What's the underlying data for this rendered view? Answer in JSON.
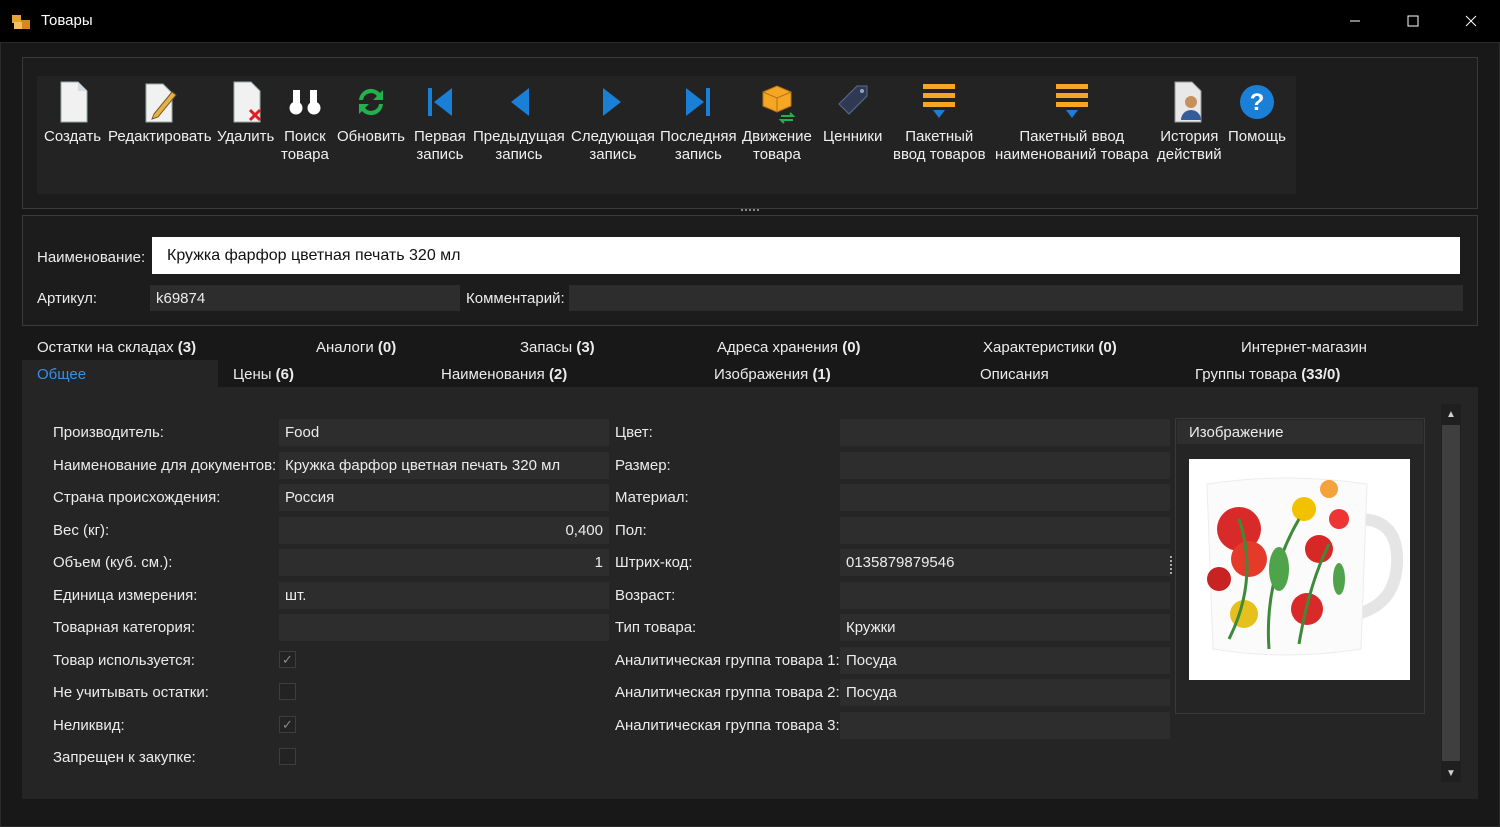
{
  "window": {
    "title": "Товары",
    "minimize": "—",
    "maximize": "☐",
    "close": "✕"
  },
  "toolbar": {
    "create": "Создать",
    "edit": "Редактировать",
    "delete": "Удалить",
    "search_l1": "Поиск",
    "search_l2": "товара",
    "refresh": "Обновить",
    "first_l1": "Первая",
    "first_l2": "запись",
    "prev_l1": "Предыдущая",
    "prev_l2": "запись",
    "next_l1": "Следующая",
    "next_l2": "запись",
    "last_l1": "Последняя",
    "last_l2": "запись",
    "move_l1": "Движение",
    "move_l2": "товара",
    "prices": "Ценники",
    "batch_l1": "Пакетный",
    "batch_l2": "ввод товаров",
    "batchnames_l1": "Пакетный ввод",
    "batchnames_l2": "наименований товара",
    "history_l1": "История",
    "history_l2": "действий",
    "help": "Помощь"
  },
  "header": {
    "name_label": "Наименование:",
    "name_value": "Кружка фарфор цветная печать 320 мл",
    "article_label": "Артикул:",
    "article_value": "k69874",
    "comment_label": "Комментарий:",
    "comment_value": ""
  },
  "tabs_row1": [
    {
      "label": "Остатки на складах ",
      "count": "(3)"
    },
    {
      "label": "Аналоги ",
      "count": "(0)"
    },
    {
      "label": "Запасы ",
      "count": "(3)"
    },
    {
      "label": "Адреса хранения ",
      "count": "(0)"
    },
    {
      "label": "Характеристики ",
      "count": "(0)"
    },
    {
      "label": "Интернет-магазин",
      "count": ""
    }
  ],
  "tabs_row2": [
    {
      "label": "Общее",
      "count": ""
    },
    {
      "label": "Цены ",
      "count": "(6)"
    },
    {
      "label": "Наименования ",
      "count": "(2)"
    },
    {
      "label": "Изображения ",
      "count": "(1)"
    },
    {
      "label": "Описания",
      "count": ""
    },
    {
      "label": "Группы товара ",
      "count": "(33/0)"
    }
  ],
  "general": {
    "left": [
      {
        "label": "Производитель:",
        "value": "Food"
      },
      {
        "label": "Наименование для документов:",
        "value": "Кружка фарфор цветная печать 320 мл"
      },
      {
        "label": "Страна происхождения:",
        "value": "Россия"
      },
      {
        "label": "Вес (кг):",
        "value": "0,400"
      },
      {
        "label": "Объем (куб. см.):",
        "value": "1"
      },
      {
        "label": "Единица измерения:",
        "value": "шт."
      },
      {
        "label": "Товарная категория:",
        "value": ""
      }
    ],
    "checks": [
      {
        "label": "Товар используется:",
        "mark": "✓"
      },
      {
        "label": "Не учитывать остатки:",
        "mark": ""
      },
      {
        "label": "Неликвид:",
        "mark": "✓"
      },
      {
        "label": "Запрещен к закупке:",
        "mark": ""
      }
    ],
    "right": [
      {
        "label": "Цвет:",
        "value": ""
      },
      {
        "label": "Размер:",
        "value": ""
      },
      {
        "label": "Материал:",
        "value": ""
      },
      {
        "label": "Пол:",
        "value": ""
      },
      {
        "label": "Штрих-код:",
        "value": "0135879879546"
      },
      {
        "label": "Возраст:",
        "value": ""
      },
      {
        "label": "Тип товара:",
        "value": "Кружки"
      },
      {
        "label": "Аналитическая группа товара 1:",
        "value": "Посуда"
      },
      {
        "label": "Аналитическая группа товара 2:",
        "value": "Посуда"
      },
      {
        "label": "Аналитическая группа товара 3:",
        "value": ""
      }
    ],
    "image_title": "Изображение"
  },
  "scroll": {
    "up": "▲",
    "down": "▼"
  },
  "colors": {
    "accent": "#3b8fe0",
    "toolbar_blue": "#1a7fd6",
    "refresh_green": "#22b14c",
    "orange": "#f5a623"
  }
}
